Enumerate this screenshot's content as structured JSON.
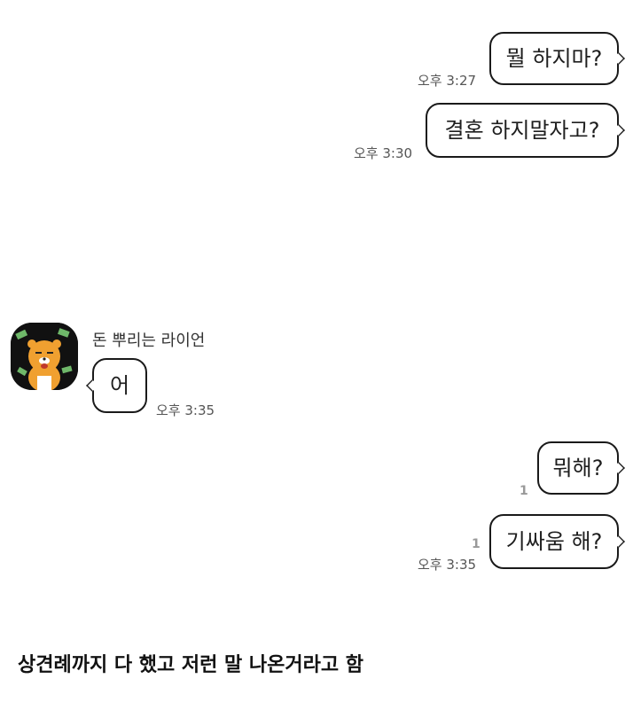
{
  "messages": [
    {
      "text": "뭘 하지마?",
      "time": "오후 3:27"
    },
    {
      "text": "결혼 하지말자고?",
      "time": "오후 3:30"
    },
    {
      "sender": "돈 뿌리는 라이언",
      "text": "어",
      "time": "오후 3:35"
    },
    {
      "text": "뭐해?",
      "unread": "1"
    },
    {
      "text": "기싸움 해?",
      "unread": "1",
      "time": "오후 3:35"
    }
  ],
  "caption": "상견례까지 다 했고 저런 말 나온거라고 함",
  "colors": {
    "background": "#ffffff",
    "bubble_border": "#1a1a1a",
    "avatar_bg": "#111111",
    "avatar_face": "#f0a030"
  }
}
